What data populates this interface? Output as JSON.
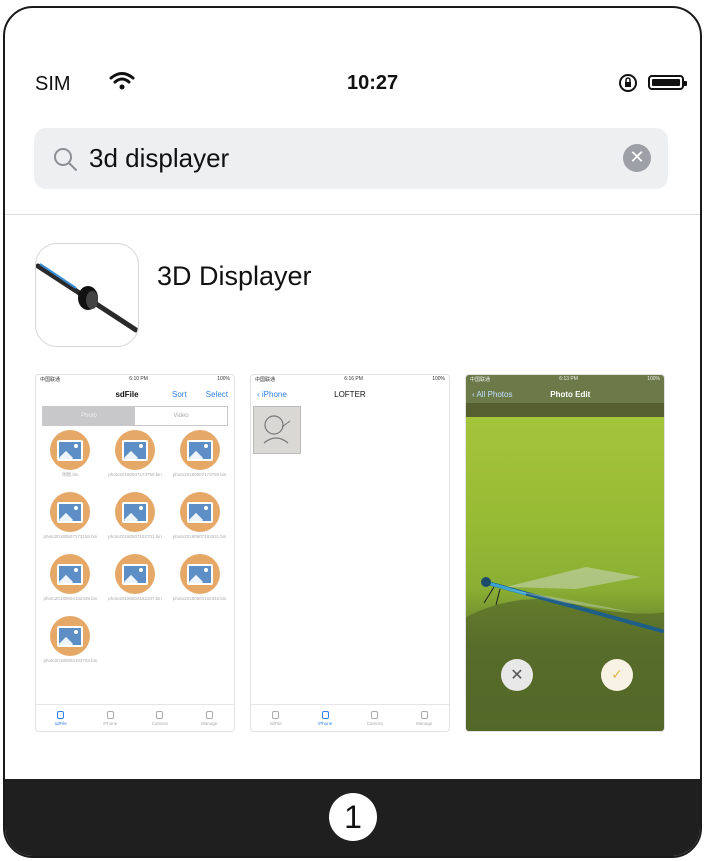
{
  "status_bar": {
    "carrier": "SIM",
    "time": "10:27"
  },
  "search": {
    "query": "3d displayer",
    "icons": [
      "magnifier-icon",
      "clear-icon"
    ]
  },
  "result": {
    "app_name": "3D Displayer"
  },
  "screenshots": [
    {
      "status_left": "中国联通",
      "status_time": "6:10 PM",
      "status_right": "100%",
      "nav_title": "sdFile",
      "nav_actions": [
        "Sort",
        "Select"
      ],
      "segments": [
        "Photo",
        "Video"
      ],
      "files": [
        "图图.bin",
        "photo20180507173759.bin",
        "photo20180507173750.bin",
        "photo20180507173158.bin",
        "photo20180507152701.bin",
        "photo20180507152631.bin",
        "photo2018050416234​9.bin",
        "photo20180504162347.bin",
        "photo20180504162345.bin",
        "photo20180503182703.bin"
      ],
      "tabs": [
        "sdFile",
        "iPhone",
        "Camera",
        "Manage"
      ],
      "active_tab": 0
    },
    {
      "status_left": "中国联通",
      "status_time": "6:16 PM",
      "status_right": "100%",
      "back_label": "iPhone",
      "nav_title": "LOFTER",
      "tabs": [
        "sdFile",
        "iPhone",
        "Camera",
        "Manage"
      ],
      "active_tab": 1
    },
    {
      "status_left": "中国联通",
      "status_time": "6:13 PM",
      "status_right": "100%",
      "back_label": "All Photos",
      "nav_title": "Photo Edit"
    }
  ],
  "footer": {
    "step_number": "1"
  },
  "colors": {
    "accent": "#2f80ed",
    "folder": "#e6a867",
    "footer": "#1f1f1f"
  }
}
